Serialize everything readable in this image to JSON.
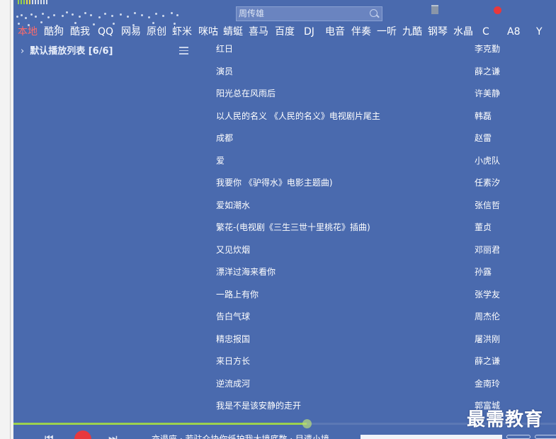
{
  "header": {
    "search_value": "周传雄"
  },
  "tabs": [
    {
      "label": "本地",
      "active": true
    },
    {
      "label": "酷狗"
    },
    {
      "label": "酷我"
    },
    {
      "label": "QQ"
    },
    {
      "label": "网易"
    },
    {
      "label": "原创"
    },
    {
      "label": "虾米"
    },
    {
      "label": "咪咕"
    },
    {
      "label": "蜻蜓"
    },
    {
      "label": "喜马"
    },
    {
      "label": "百度"
    },
    {
      "label": "DJ"
    },
    {
      "label": "电音"
    },
    {
      "label": "伴奏"
    },
    {
      "label": "一听"
    },
    {
      "label": "九酷"
    },
    {
      "label": "钢琴"
    },
    {
      "label": "水晶"
    },
    {
      "label": "C"
    },
    {
      "label": "A8"
    },
    {
      "label": "Y"
    }
  ],
  "sidebar": {
    "playlist_title": "默认播放列表 [6/6]"
  },
  "songs": [
    {
      "title": "红日",
      "artist": "李克勤"
    },
    {
      "title": "演员",
      "artist": "薛之谦"
    },
    {
      "title": "阳光总在风雨后",
      "artist": "许美静"
    },
    {
      "title": "以人民的名义 《人民的名义》电视剧片尾主",
      "artist": "韩磊"
    },
    {
      "title": "成都",
      "artist": "赵雷"
    },
    {
      "title": "爱",
      "artist": "小虎队"
    },
    {
      "title": "我要你 《驴得水》电影主题曲)",
      "artist": "任素汐"
    },
    {
      "title": "爱如潮水",
      "artist": "张信哲"
    },
    {
      "title": "繁花-(电视剧《三生三世十里桃花》插曲)",
      "artist": "董贞"
    },
    {
      "title": "又见炊烟",
      "artist": "邓丽君"
    },
    {
      "title": "漂洋过海来看你",
      "artist": "孙露"
    },
    {
      "title": "一路上有你",
      "artist": "张学友"
    },
    {
      "title": "告白气球",
      "artist": "周杰伦"
    },
    {
      "title": "精忠报国",
      "artist": "屠洪刚"
    },
    {
      "title": "来日方长",
      "artist": "薛之谦"
    },
    {
      "title": "逆流成河",
      "artist": "金南玲"
    },
    {
      "title": "我是不是该安静的走开",
      "artist": "郭富城"
    }
  ],
  "player": {
    "progress": 0.54,
    "now_playing": "亦退座 · 若驻众协你纸护我大境底数 · 目遗小境"
  },
  "watermark": "最需教育",
  "colors": {
    "background": "#4a6aae",
    "active_tab": "#ff6a6a",
    "progress": "#9cd14e",
    "record": "#e8383c"
  }
}
